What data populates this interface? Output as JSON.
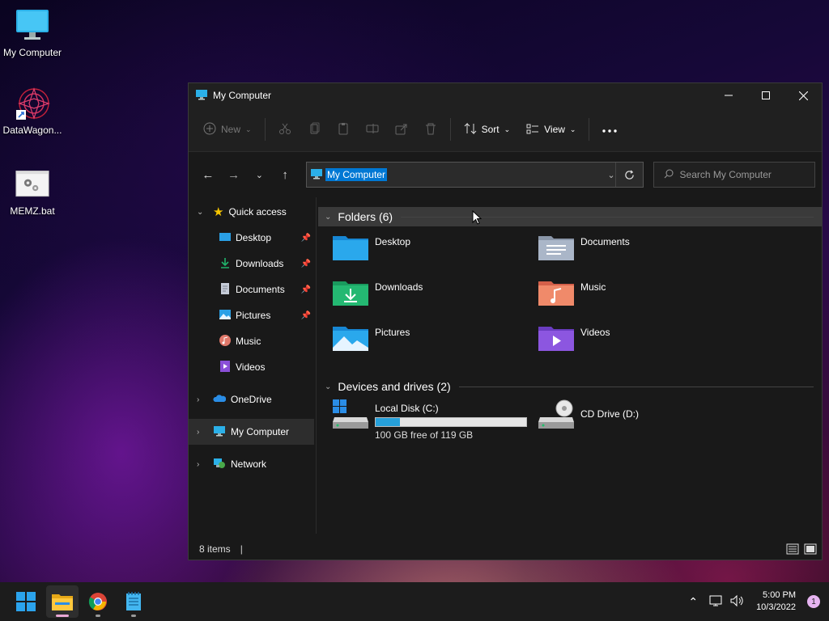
{
  "desktop": {
    "icons": [
      {
        "label": "My Computer"
      },
      {
        "label": "DataWagon..."
      },
      {
        "label": "MEMZ.bat"
      }
    ]
  },
  "window": {
    "title": "My Computer",
    "toolbar": {
      "new_label": "New",
      "sort_label": "Sort",
      "view_label": "View"
    },
    "address": {
      "value": "My Computer"
    },
    "search": {
      "placeholder": "Search My Computer"
    },
    "sidebar": {
      "quick_access": "Quick access",
      "items": [
        {
          "label": "Desktop"
        },
        {
          "label": "Downloads"
        },
        {
          "label": "Documents"
        },
        {
          "label": "Pictures"
        },
        {
          "label": "Music"
        },
        {
          "label": "Videos"
        }
      ],
      "onedrive": "OneDrive",
      "my_computer": "My Computer",
      "network": "Network"
    },
    "folders_header": "Folders (6)",
    "folders": [
      {
        "name": "Desktop"
      },
      {
        "name": "Documents"
      },
      {
        "name": "Downloads"
      },
      {
        "name": "Music"
      },
      {
        "name": "Pictures"
      },
      {
        "name": "Videos"
      }
    ],
    "devices_header": "Devices and drives (2)",
    "drives": [
      {
        "name": "Local Disk (C:)",
        "free_text": "100 GB free of 119 GB",
        "used_fraction": 0.16
      },
      {
        "name": "CD Drive (D:)"
      }
    ],
    "status": {
      "items": "8 items"
    }
  },
  "taskbar": {
    "time": "5:00 PM",
    "date": "10/3/2022",
    "notifications": "1"
  },
  "colors": {
    "accent": "#0078d4",
    "folder_blue": "#2aa0e6",
    "green": "#21b36b"
  }
}
